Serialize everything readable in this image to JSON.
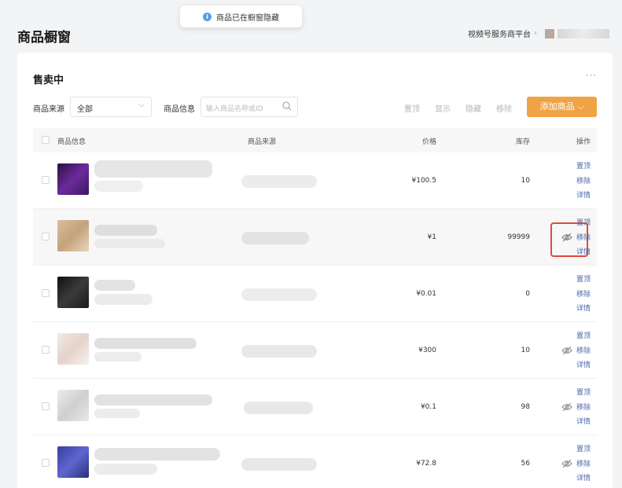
{
  "toast": {
    "icon": "info-icon",
    "text": "商品已在橱窗隐藏"
  },
  "header": {
    "title": "商品橱窗",
    "platform_link": "视频号服务商平台",
    "chevron": "›"
  },
  "panel": {
    "title": "售卖中",
    "more": "···"
  },
  "filters": {
    "source_label": "商品来源",
    "source_value": "全部",
    "info_label": "商品信息",
    "search_placeholder": "输入商品名称或ID"
  },
  "bulk_actions": {
    "pin": "置顶",
    "show": "显示",
    "hide": "隐藏",
    "remove": "移除"
  },
  "add_button": {
    "label": "添加商品 ⌵"
  },
  "table": {
    "columns": {
      "info": "商品信息",
      "source": "商品来源",
      "price": "价格",
      "stock": "库存",
      "ops": "操作"
    },
    "rows": [
      {
        "price": "¥100.5",
        "stock": "10",
        "hidden": false,
        "ops": [
          "置顶",
          "移除",
          "详情"
        ]
      },
      {
        "price": "¥1",
        "stock": "99999",
        "hidden": true,
        "ops": [
          "置顶",
          "移除",
          "详情"
        ]
      },
      {
        "price": "¥0.01",
        "stock": "0",
        "hidden": false,
        "ops": [
          "置顶",
          "移除",
          "详情"
        ]
      },
      {
        "price": "¥300",
        "stock": "10",
        "hidden": true,
        "ops": [
          "置顶",
          "移除",
          "详情"
        ]
      },
      {
        "price": "¥0.1",
        "stock": "98",
        "hidden": true,
        "ops": [
          "置顶",
          "移除",
          "详情"
        ]
      },
      {
        "price": "¥72.8",
        "stock": "56",
        "hidden": true,
        "ops": [
          "置顶",
          "移除",
          "详情"
        ]
      }
    ]
  },
  "colors": {
    "accent": "#f0a344",
    "link": "#4a68a8",
    "highlight_box": "#e04a3c"
  }
}
